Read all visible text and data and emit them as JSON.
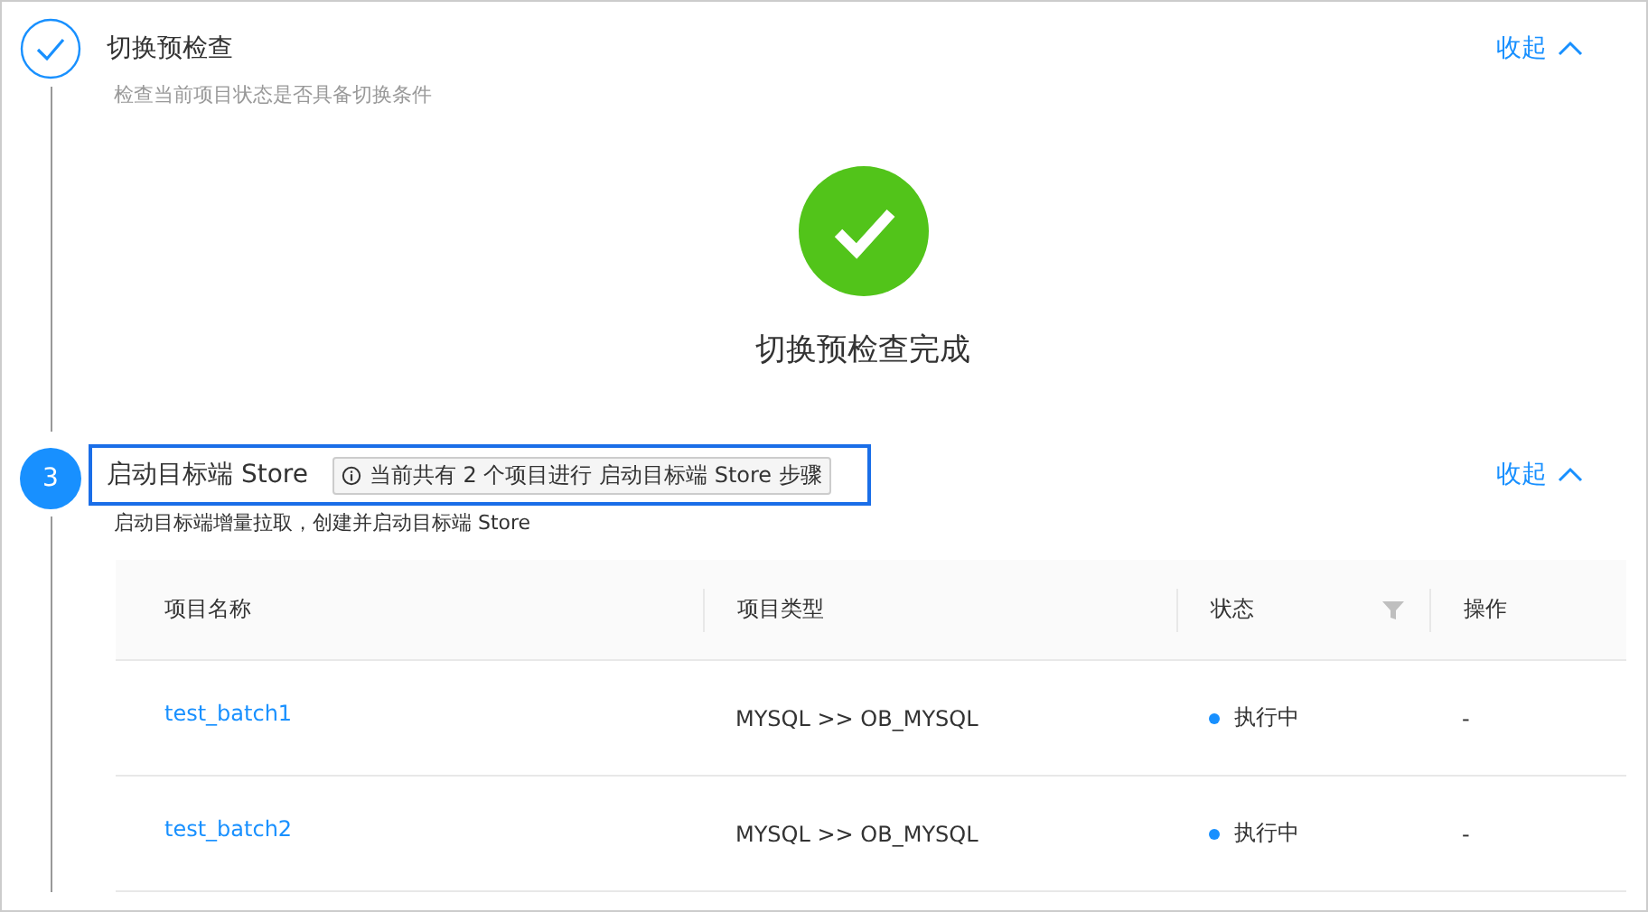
{
  "steps": [
    {
      "completed": true,
      "title": "切换预检查",
      "description": "检查当前项目状态是否具备切换条件",
      "toggle": "收起",
      "expanded": true,
      "result": {
        "kind": "success",
        "text": "切换预检查完成"
      }
    },
    {
      "completed": false,
      "number": "3",
      "title": "启动目标端 Store",
      "tag": "当前共有 2 个项目进行 启动目标端 Store 步骤",
      "highlighted": true,
      "description": "启动目标端增量拉取，创建并启动目标端 Store",
      "toggle": "收起",
      "expanded": true,
      "table": {
        "columns": [
          {
            "label": "项目名称",
            "filter": false
          },
          {
            "label": "项目类型",
            "filter": false
          },
          {
            "label": "状态",
            "filter": true
          },
          {
            "label": "操作",
            "filter": false
          }
        ],
        "rows": [
          {
            "name": "test_batch1",
            "type": "MYSQL >> OB_MYSQL",
            "status": {
              "text": "执行中",
              "color": "#1890ff"
            },
            "action": "-"
          },
          {
            "name": "test_batch2",
            "type": "MYSQL >> OB_MYSQL",
            "status": {
              "text": "执行中",
              "color": "#1890ff"
            },
            "action": "-"
          }
        ]
      }
    }
  ]
}
